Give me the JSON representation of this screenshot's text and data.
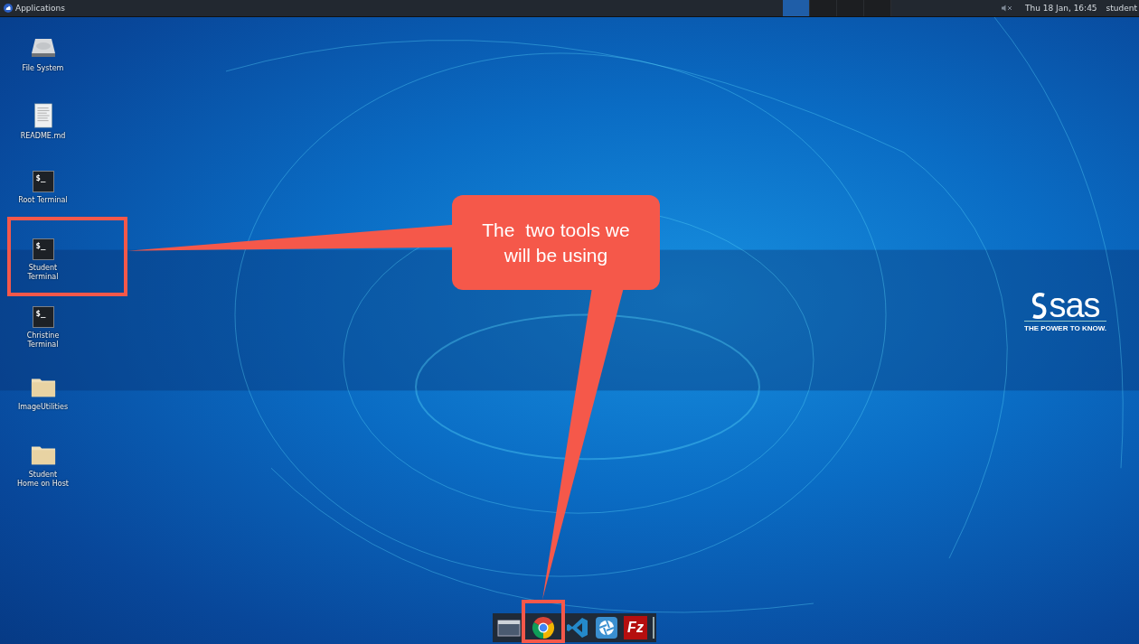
{
  "top_panel": {
    "menu_label": "Applications",
    "workspaces": [
      {
        "selected": true
      },
      {
        "selected": false
      },
      {
        "selected": false
      },
      {
        "selected": false
      }
    ],
    "volume_muted": true,
    "clock": "Thu 18 Jan, 16:45",
    "user": "student"
  },
  "desktop_icons": [
    {
      "kind": "drive",
      "label": [
        "File System"
      ],
      "highlighted": false
    },
    {
      "kind": "document",
      "label": [
        "README.md"
      ],
      "highlighted": false
    },
    {
      "kind": "terminal",
      "label": [
        "Root Terminal"
      ],
      "highlighted": false
    },
    {
      "kind": "terminal",
      "label": [
        "Student",
        "Terminal"
      ],
      "highlighted": true
    },
    {
      "kind": "terminal",
      "label": [
        "Christine",
        "Terminal"
      ],
      "highlighted": false
    },
    {
      "kind": "folder",
      "label": [
        "ImageUtilities"
      ],
      "highlighted": false
    },
    {
      "kind": "folder",
      "label": [
        "Student",
        "Home on Host"
      ],
      "highlighted": false
    }
  ],
  "terminal_prompt": "$_",
  "logo": {
    "wordmark": "sas",
    "tagline": "THE POWER TO KNOW."
  },
  "callout": {
    "text": "The  two tools we will be using"
  },
  "dock": [
    {
      "kind": "files",
      "highlighted": false
    },
    {
      "kind": "browser",
      "highlighted": true
    },
    {
      "kind": "editor",
      "highlighted": false
    },
    {
      "kind": "shutter",
      "highlighted": false
    },
    {
      "kind": "ftp",
      "glyph": "Fz",
      "highlighted": false
    }
  ]
}
